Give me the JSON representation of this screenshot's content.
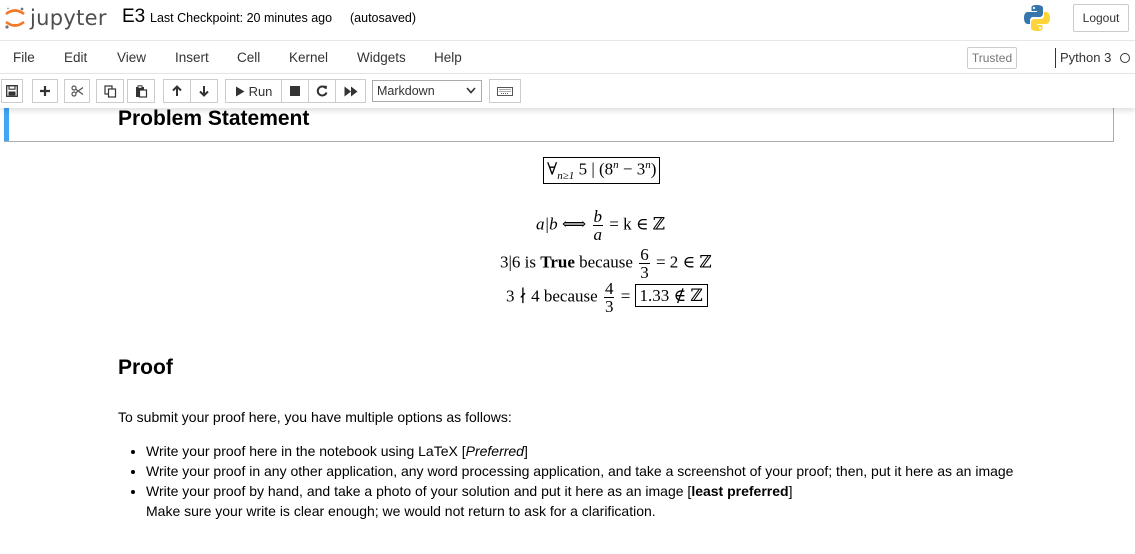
{
  "header": {
    "logo_text": "jupyter",
    "notebook_name": "E3",
    "checkpoint_text": "Last Checkpoint: 20 minutes ago",
    "autosave_status": "(autosaved)",
    "logout_label": "Logout"
  },
  "menubar": {
    "items": [
      "File",
      "Edit",
      "View",
      "Insert",
      "Cell",
      "Kernel",
      "Widgets",
      "Help"
    ],
    "trusted_label": "Trusted",
    "kernel_name": "Python 3"
  },
  "toolbar": {
    "buttons": [
      "save-icon",
      "plus-icon",
      "scissors-icon",
      "copy-icon",
      "paste-icon",
      "arrow-up-icon",
      "arrow-down-icon",
      "run-icon",
      "stop-icon",
      "restart-icon",
      "fast-forward-icon",
      "keyboard-icon"
    ],
    "run_label": "Run",
    "cell_type": "Markdown"
  },
  "cell": {
    "heading": "Problem Statement",
    "theorem": {
      "forall": "∀",
      "subscript": "n≥1",
      "body": "5 | (8",
      "sup_n": "n",
      "minus": " − 3",
      "tail": ")"
    },
    "definition": {
      "lhs": "a|b  ⟺ ",
      "numerator": "b",
      "denominator": "a",
      "rhs": "= k ∈ ℤ"
    },
    "example_true": {
      "prefix": "3|6 is ",
      "bold": "True",
      "mid": " because ",
      "numerator": "6",
      "denominator": "3",
      "rhs": "= 2 ∈ ℤ"
    },
    "example_false": {
      "prefix": "3 ∤ 4 because ",
      "numerator": "4",
      "denominator": "3",
      "eq": "=",
      "boxed": "1.33 ∉ ℤ"
    }
  },
  "proof": {
    "heading": "Proof",
    "intro": "To submit your proof here, you have multiple options as follows:",
    "options": [
      {
        "text": "Write your proof here in the notebook using LaTeX [",
        "emph": "Preferred",
        "tail": "]"
      },
      {
        "text": "Write your proof in any other application, any word processing application, and take a screenshot of your proof; then, put it here as an image"
      },
      {
        "text": "Write your proof by hand, and take a photo of your solution and put it here as an image [",
        "bold": "least preferred",
        "tail": "]",
        "note": "Make sure your write is clear enough; we would not return to ask for a clarification."
      }
    ]
  },
  "colors": {
    "accent": "#42a5f5",
    "jupyter_orange": "#f37726",
    "python_blue": "#3776ab",
    "python_yellow": "#ffd43b"
  }
}
